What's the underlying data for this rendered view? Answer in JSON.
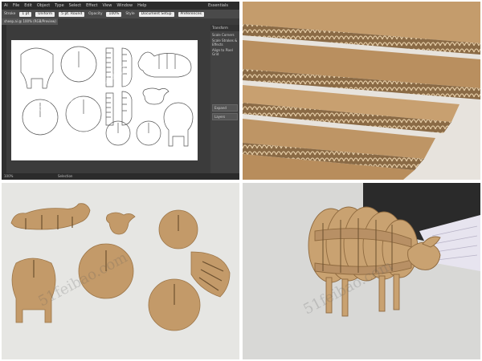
{
  "illustrator": {
    "menus": [
      "Ai",
      "File",
      "Edit",
      "Object",
      "Type",
      "Select",
      "Effect",
      "View",
      "Window",
      "Help"
    ],
    "workspace": "Essentials",
    "options": {
      "stroke_label": "Stroke",
      "stroke_value": "1 pt",
      "brush_value": "Uniform",
      "basic_label": "5 pt. Round",
      "opacity_label": "Opacity",
      "opacity_value": "100%",
      "style_label": "Style",
      "document_setup": "Document Setup",
      "preferences": "Preferences"
    },
    "doc_tab": "sheep.ai @ 100% (RGB/Preview)",
    "panel": {
      "title": "Transform",
      "rows": [
        "Scale Corners",
        "Scale Strokes & Effects",
        "Align to Pixel Grid"
      ],
      "buttons": [
        "Expand",
        "Layers"
      ]
    },
    "status": {
      "zoom": "100%",
      "tool": "Selection"
    }
  },
  "watermark": "51feibao.com",
  "colors": {
    "cardboard": "#c9a271",
    "cardboard_dark": "#9c7547",
    "ui_dark": "#3b3b3b"
  }
}
